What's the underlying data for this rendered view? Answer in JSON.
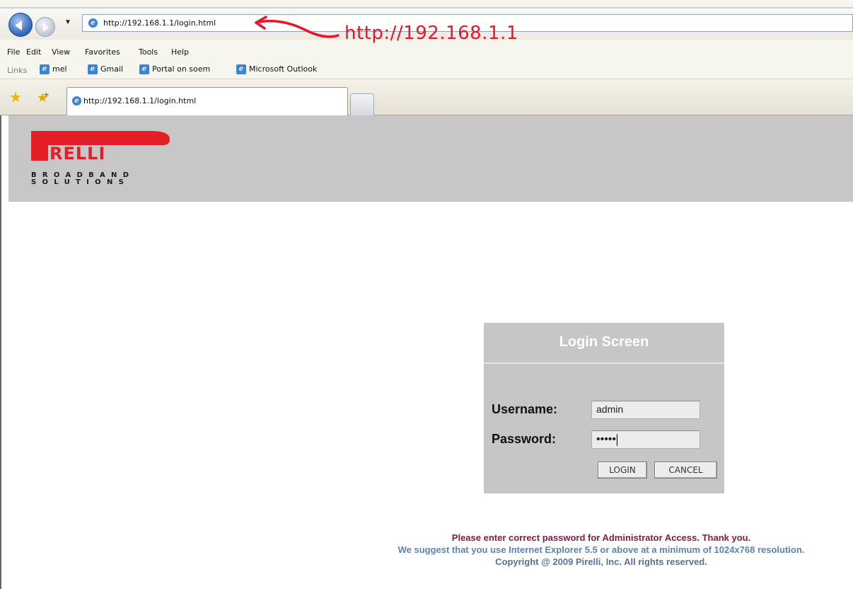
{
  "browser": {
    "address_url": "http://192.168.1.1/login.html",
    "annotation": "http://192.168.1.1",
    "menu": [
      "File",
      "Edit",
      "View",
      "Favorites",
      "Tools",
      "Help"
    ],
    "links_label": "Links",
    "links": [
      "mel",
      "Gmail",
      "Portal on soem",
      "Microsoft Outlook"
    ],
    "tab_title": "http://192.168.1.1/login.html"
  },
  "header": {
    "brand": "PIRELLI",
    "brand_sub_line1": "BROADBAND",
    "brand_sub_line2": "SOLUTIONS"
  },
  "login": {
    "title": "Login Screen",
    "username_label": "Username:",
    "username_value": "admin",
    "password_label": "Password:",
    "password_value": "•••••",
    "login_button": "LOGIN",
    "cancel_button": "CANCEL"
  },
  "footer": {
    "line1": "Please enter correct password for Administrator Access. Thank you.",
    "line2": "We suggest that you use Internet Explorer 5.5 or above at a minimum of 1024x768 resolution.",
    "line3": "Copyright @ 2009 Pirelli, Inc. All rights reserved."
  },
  "colors": {
    "annotation": "#e8162a",
    "brand_red": "#e41e26",
    "header_band": "#c7c7c7",
    "login_box": "#c6c6c6",
    "footer_line1": "#8b1a43",
    "footer_line2": "#5c83b1"
  }
}
